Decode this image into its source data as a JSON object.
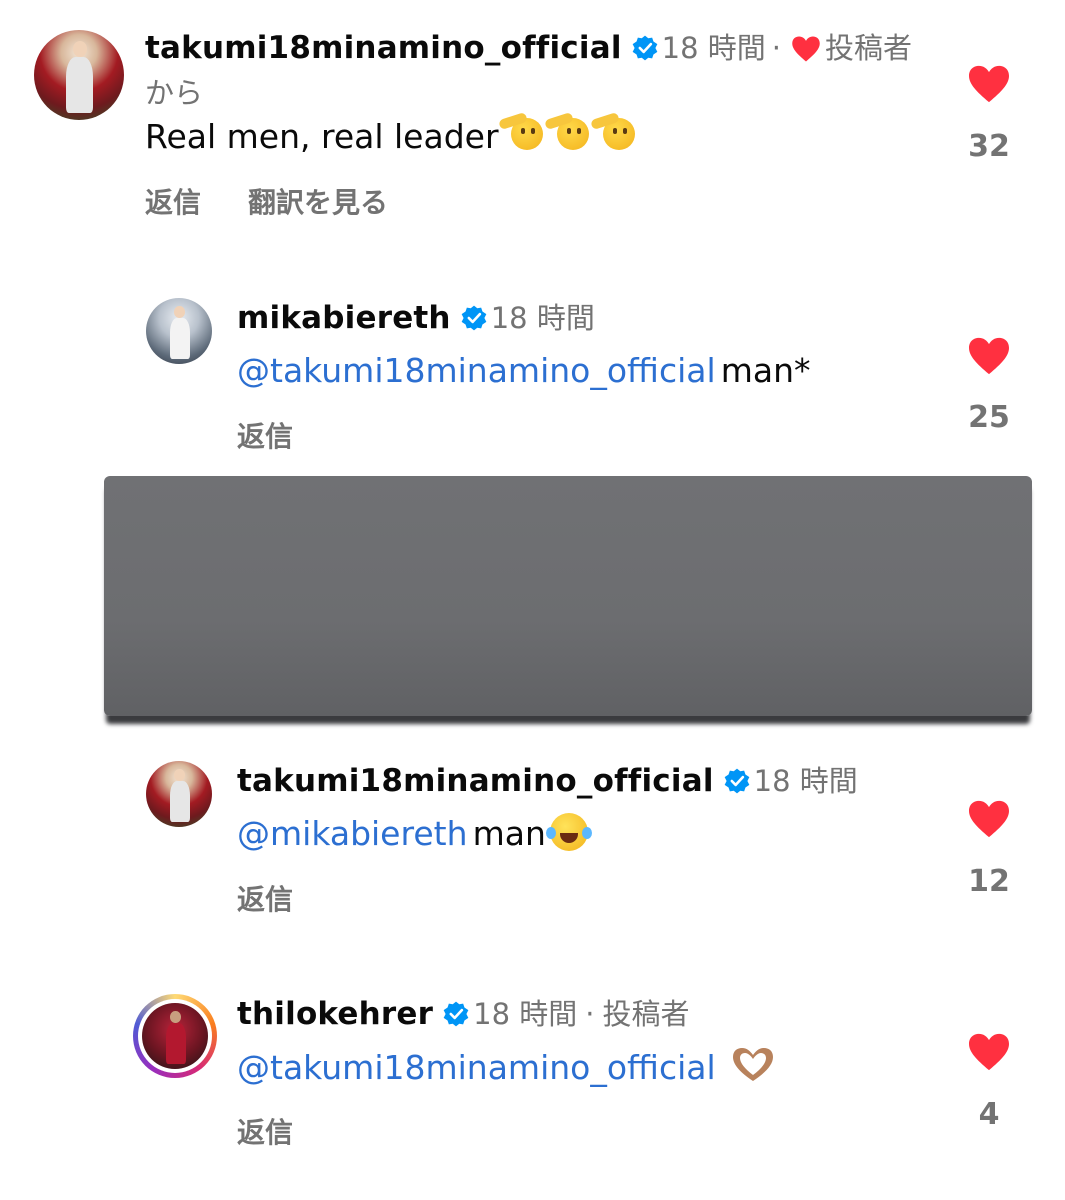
{
  "comments": [
    {
      "username": "takumi18minamino_official",
      "time": "18 時間",
      "separator": "·",
      "author_badge": "投稿者から",
      "text": "Real men, real leader",
      "emoji": "saluting-face-x3",
      "reply_label": "返信",
      "translate_label": "翻訳を見る",
      "like_count": "32"
    },
    {
      "username": "mikabiereth",
      "time": "18 時間",
      "mention": "@takumi18minamino_official",
      "text": "man*",
      "reply_label": "返信",
      "like_count": "25"
    },
    {
      "username": "takumi18minamino_official",
      "time": "18 時間",
      "mention": "@mikabiereth",
      "text": "man",
      "emoji": "face-with-tears-of-joy",
      "reply_label": "返信",
      "like_count": "12"
    },
    {
      "username": "thilokehrer",
      "time": "18 時間",
      "separator": "·",
      "author_badge": "投稿者",
      "mention": "@takumi18minamino_official",
      "emoji": "heart-hands",
      "reply_label": "返信",
      "like_count": "4"
    }
  ],
  "colors": {
    "like_red": "#ff3040",
    "mention_blue": "#2c6fd1",
    "verified_blue": "#0095f6",
    "meta_gray": "#737373",
    "redaction_gray": "#6c6d70"
  }
}
